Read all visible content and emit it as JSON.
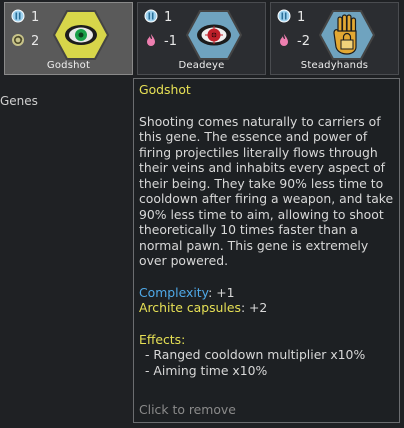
{
  "genes": [
    {
      "name": "Godshot",
      "complexity": "1",
      "secondary": "2",
      "secondary_icon": "archite-capsule-icon",
      "icon": "godshot-eye-icon"
    },
    {
      "name": "Deadeye",
      "complexity": "1",
      "secondary": "-1",
      "secondary_icon": "metabolism-icon",
      "icon": "deadeye-icon"
    },
    {
      "name": "Steadyhands",
      "complexity": "1",
      "secondary": "-2",
      "secondary_icon": "metabolism-icon",
      "icon": "steady-hand-icon"
    }
  ],
  "section_label": "Genes",
  "tooltip": {
    "title": "Godshot",
    "description": "Shooting comes naturally to carriers of this gene. The essence and power of firing projectiles literally flows through their veins and inhabits every aspect of their being. They take 90% less time to cooldown after firing a weapon, and take 90% less time to aim, allowing to shoot theoretically 10 times faster than a normal pawn. This gene is extremely over powered.",
    "complexity_label": "Complexity",
    "complexity_value": ": +1",
    "archite_label": "Archite capsules",
    "archite_value": ": +2",
    "effects_title": "Effects:",
    "effects": [
      "- Ranged cooldown multiplier x10%",
      "- Aiming time x10%"
    ],
    "remove_hint": "Click to remove"
  },
  "colors": {
    "title": "#e6e055",
    "complexity": "#4fa9e8",
    "background": "#1f2124"
  }
}
